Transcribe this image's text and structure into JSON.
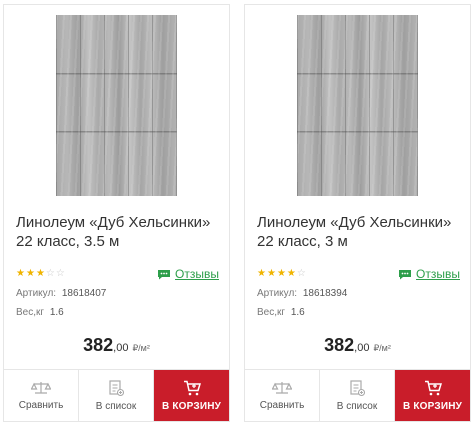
{
  "colors": {
    "accent_green": "#2d9e4a",
    "cart_red": "#c91d2a",
    "star": "#f0b400"
  },
  "products": [
    {
      "title": "Линолеум «Дуб Хельсинки» 22 класс, 3.5 м",
      "rating": 3,
      "rating_max": 5,
      "reviews_label": "Отзывы",
      "sku_label": "Артикул:",
      "sku": "18618407",
      "weight_label": "Вес,кг",
      "weight": "1.6",
      "price_main": "382",
      "price_cents": ",00",
      "price_unit": "₽/м²",
      "compare_label": "Сравнить",
      "list_label": "В список",
      "cart_label": "В КОРЗИНУ",
      "icons": [
        "scales-icon",
        "list-icon",
        "cart-icon",
        "chat-icon"
      ]
    },
    {
      "title": "Линолеум «Дуб Хельсинки» 22 класс, 3 м",
      "rating": 4,
      "rating_max": 5,
      "reviews_label": "Отзывы",
      "sku_label": "Артикул:",
      "sku": "18618394",
      "weight_label": "Вес,кг",
      "weight": "1.6",
      "price_main": "382",
      "price_cents": ",00",
      "price_unit": "₽/м²",
      "compare_label": "Сравнить",
      "list_label": "В список",
      "cart_label": "В КОРЗИНУ",
      "icons": [
        "scales-icon",
        "list-icon",
        "cart-icon",
        "chat-icon"
      ]
    }
  ]
}
